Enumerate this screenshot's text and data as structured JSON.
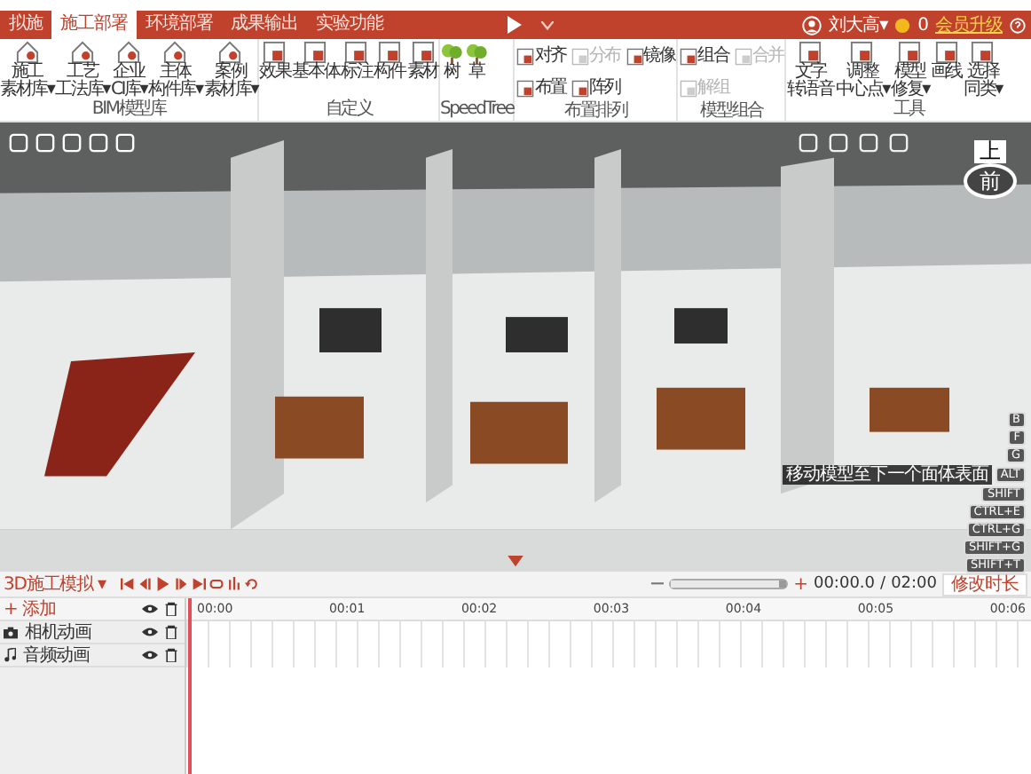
{
  "tabs": [
    {
      "label": "拟施",
      "selected": false
    },
    {
      "label": "施工部署",
      "selected": true
    },
    {
      "label": "环境部署",
      "selected": false
    },
    {
      "label": "成果输出",
      "selected": false
    },
    {
      "label": "实验功能",
      "selected": false
    }
  ],
  "user": {
    "name": "刘大高▾",
    "coins": "0",
    "upgrade": "会员升级"
  },
  "ribbon": [
    {
      "label": "BIM模型库",
      "kind": "large",
      "buttons": [
        {
          "lines": [
            "施工",
            "素材库▾"
          ],
          "disabled": false
        },
        {
          "lines": [
            "工艺",
            "工法库▾"
          ],
          "disabled": false
        },
        {
          "lines": [
            "企业",
            "CI库▾"
          ],
          "disabled": false
        },
        {
          "lines": [
            "主体",
            "构件库▾"
          ],
          "disabled": false
        },
        {
          "lines": [
            "案例",
            "素材库▾"
          ],
          "disabled": false
        }
      ]
    },
    {
      "label": "自定义",
      "kind": "large",
      "buttons": [
        {
          "lines": [
            "效果"
          ],
          "disabled": false
        },
        {
          "lines": [
            "基本体"
          ],
          "disabled": false
        },
        {
          "lines": [
            "标注"
          ],
          "disabled": false
        },
        {
          "lines": [
            "构件"
          ],
          "disabled": false
        },
        {
          "lines": [
            "素材"
          ],
          "disabled": false
        }
      ]
    },
    {
      "label": "SpeedTree",
      "kind": "large",
      "buttons": [
        {
          "lines": [
            "树"
          ],
          "disabled": false
        },
        {
          "lines": [
            "草"
          ],
          "disabled": false
        }
      ]
    },
    {
      "label": "布置排列",
      "kind": "stacked",
      "buttons": [
        {
          "lines": [
            "对齐"
          ],
          "disabled": false
        },
        {
          "lines": [
            "布置"
          ],
          "disabled": false
        },
        {
          "lines": [
            "分布"
          ],
          "disabled": true
        },
        {
          "lines": [
            "阵列"
          ],
          "disabled": false
        },
        {
          "lines": [
            "镜像"
          ],
          "disabled": false
        }
      ]
    },
    {
      "label": "模型组合",
      "kind": "stacked",
      "buttons": [
        {
          "lines": [
            "组合"
          ],
          "disabled": false
        },
        {
          "lines": [
            "解组"
          ],
          "disabled": true
        },
        {
          "lines": [
            "合并"
          ],
          "disabled": true
        }
      ]
    },
    {
      "label": "工具",
      "kind": "large",
      "buttons": [
        {
          "lines": [
            "文字",
            "转语音"
          ],
          "disabled": false
        },
        {
          "lines": [
            "调整",
            "中心点▾"
          ],
          "disabled": false
        },
        {
          "lines": [
            "模型",
            "修复▾"
          ],
          "disabled": false
        },
        {
          "lines": [
            "画线"
          ],
          "disabled": false
        },
        {
          "lines": [
            "选择",
            "同类▾"
          ],
          "disabled": false
        }
      ]
    }
  ],
  "viewport": {
    "nav_cube": {
      "top": "上",
      "front": "前"
    },
    "shortcut_keys": [
      "B",
      "F",
      "G",
      "ALT",
      "SHIFT",
      "CTRL+E",
      "CTRL+G",
      "SHIFT+G",
      "SHIFT+T"
    ],
    "tooltip": "移动模型至下一个面体表面"
  },
  "timeline": {
    "project": "3D施工模拟 ▾",
    "zoom": {
      "level": 1.0
    },
    "zoom_in": "+",
    "time": "00:00.0",
    "separator": "/",
    "duration": "02:00",
    "edit_duration": "修改时长",
    "add": "+ 添加",
    "tracks": [
      {
        "label": "相机动画",
        "kind": "camera"
      },
      {
        "label": "音频动画",
        "kind": "audio"
      }
    ],
    "ticks": [
      "00:00",
      "00:01",
      "00:02",
      "00:03",
      "00:04",
      "00:05",
      "00:06"
    ]
  }
}
